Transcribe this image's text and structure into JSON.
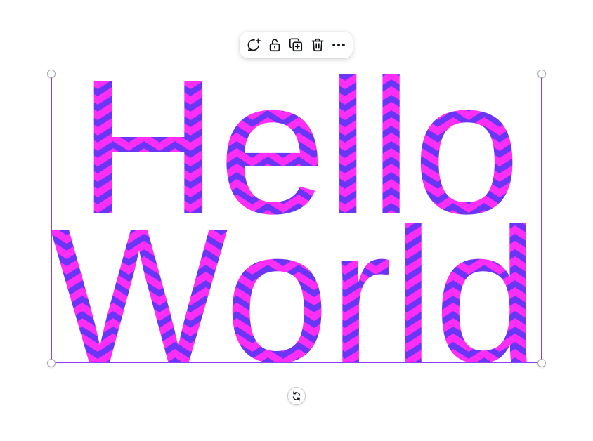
{
  "text_element": {
    "lines": [
      "Hello",
      "World"
    ],
    "pattern_colors": {
      "primary": "#ff2ef5",
      "secondary": "#6a35f5"
    }
  },
  "selection": {
    "frame_color": "#8b3dff"
  },
  "toolbar": {
    "buttons": [
      {
        "name": "add-comment",
        "icon": "comment-plus-icon"
      },
      {
        "name": "lock",
        "icon": "unlock-icon"
      },
      {
        "name": "duplicate",
        "icon": "duplicate-icon"
      },
      {
        "name": "delete",
        "icon": "trash-icon"
      },
      {
        "name": "more",
        "icon": "more-horizontal-icon"
      }
    ]
  },
  "rotate": {
    "icon": "rotate-icon"
  }
}
